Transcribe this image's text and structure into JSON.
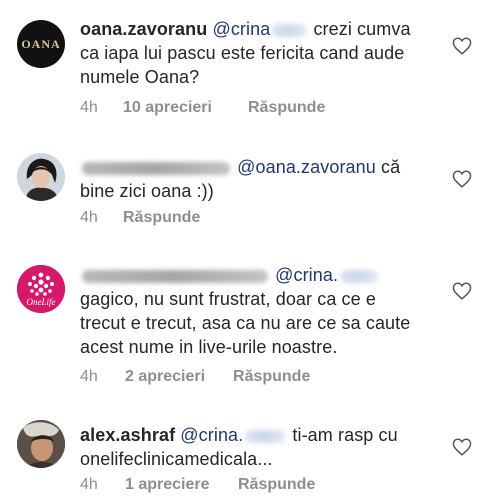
{
  "comments": [
    {
      "username": "oana.zavoranu",
      "mention": "@crina",
      "line1_rest": "crezi cumva",
      "line2": "ca iapa lui pascu este fericita cand aude",
      "line3": "numele Oana?",
      "time": "4h",
      "likes": "10 aprecieri",
      "reply": "Răspunde",
      "avatar_text": "OANA"
    },
    {
      "mention": "@oana.zavoranu",
      "line1_rest": "că",
      "line2": "bine zici oana :))",
      "time": "4h",
      "reply": "Răspunde"
    },
    {
      "mention": "@crina.",
      "line2": "gagico, nu sunt frustrat, doar ca ce e",
      "line3": "trecut e trecut, asa ca nu are ce sa caute",
      "line4": "acest nume  in live-urile noastre.",
      "time": "4h",
      "likes": "2 aprecieri",
      "reply": "Răspunde",
      "avatar_text": "OneLife"
    },
    {
      "username": "alex.ashraf",
      "mention": "@crina.",
      "line1_rest": "ti-am rasp cu",
      "line2": "onelifeclinicamedicala...",
      "time": "4h",
      "likes": "1 apreciere",
      "reply": "Răspunde"
    }
  ]
}
